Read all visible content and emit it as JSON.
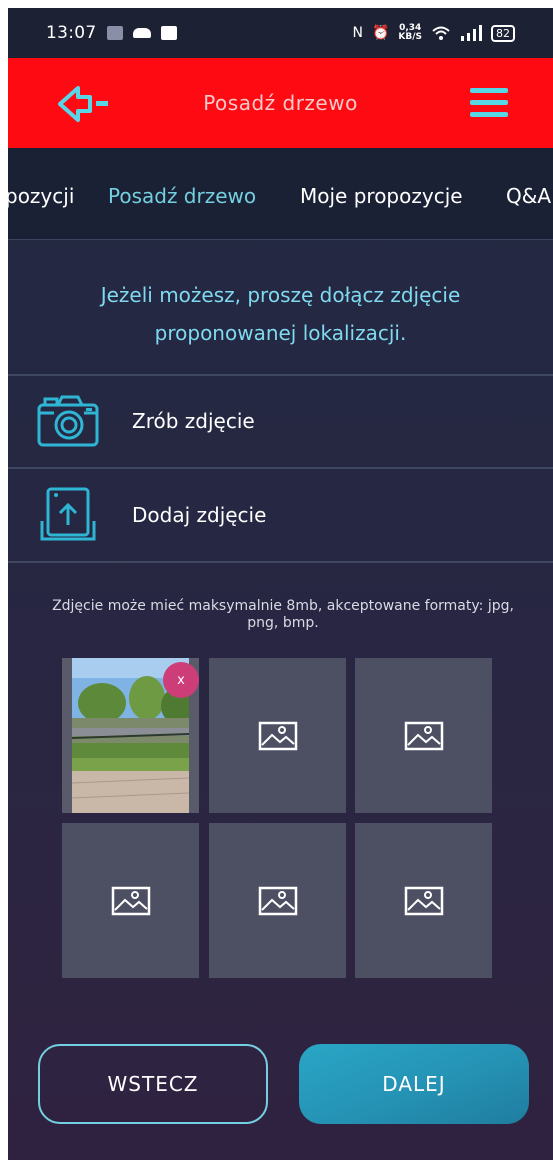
{
  "status_bar": {
    "time": "13:07",
    "net_speed_value": "0,34",
    "net_speed_unit": "KB/S",
    "battery": "82",
    "icons_left": [
      "notification-icon",
      "cloud-icon",
      "gallery-icon"
    ],
    "icons_right": [
      "nfc-icon",
      "alarm-icon",
      "wifi-icon",
      "signal-icon",
      "battery-icon"
    ]
  },
  "app_bar": {
    "title": "Posadź drzewo",
    "back_icon": "back-arrow-icon",
    "menu_icon": "hamburger-menu-icon",
    "background": "#fe0a13",
    "accent": "#57d7e6"
  },
  "tabs": [
    {
      "label": "pozycji",
      "active": false
    },
    {
      "label": "Posadź drzewo",
      "active": true
    },
    {
      "label": "Moje propozycje",
      "active": false
    },
    {
      "label": "Q&A",
      "active": false
    }
  ],
  "hint_text": "Jeżeli możesz, proszę dołącz zdjęcie proponowanej lokalizacji.",
  "actions": {
    "take_photo": {
      "label": "Zrób zdjęcie",
      "icon": "camera-icon"
    },
    "add_photo": {
      "label": "Dodaj zdjęcie",
      "icon": "upload-photo-icon"
    }
  },
  "note": "Zdjęcie może mieć maksymalnie 8mb, akceptowane formaty: jpg, png, bmp.",
  "photos": {
    "remove_label": "x",
    "slots": [
      {
        "filled": true
      },
      {
        "filled": false,
        "icon": "image-placeholder-icon"
      },
      {
        "filled": false,
        "icon": "image-placeholder-icon"
      },
      {
        "filled": false,
        "icon": "image-placeholder-icon"
      },
      {
        "filled": false,
        "icon": "image-placeholder-icon"
      },
      {
        "filled": false,
        "icon": "image-placeholder-icon"
      }
    ]
  },
  "buttons": {
    "back": "WSTECZ",
    "next": "DALEJ"
  }
}
